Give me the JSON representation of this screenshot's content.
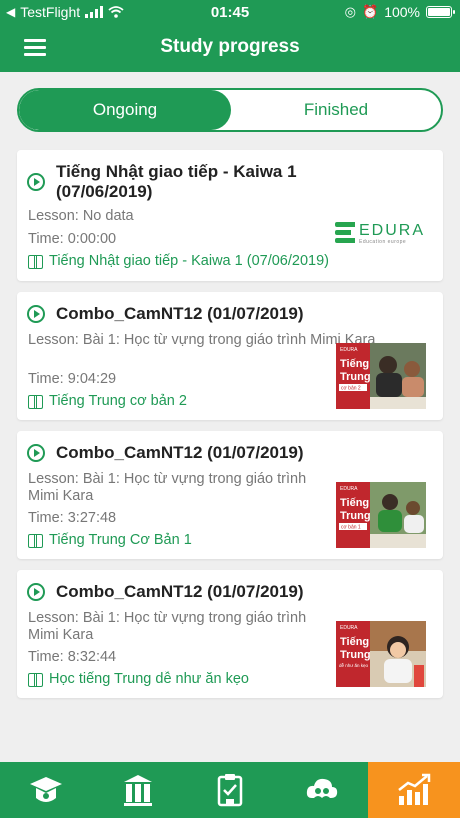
{
  "status_bar": {
    "carrier": "TestFlight",
    "time": "01:45",
    "battery": "100%",
    "battery_level": 1.0
  },
  "header": {
    "title": "Study progress",
    "menu_icon": "menu-icon"
  },
  "tabs": [
    {
      "label": "Ongoing",
      "active": true
    },
    {
      "label": "Finished",
      "active": false
    }
  ],
  "courses": [
    {
      "title": "Tiếng Nhật giao tiếp - Kaiwa 1 (07/06/2019)",
      "lesson": "Lesson: No data",
      "time": "Time: 0:00:00",
      "course": "Tiếng Nhật giao tiếp - Kaiwa 1 (07/06/2019)",
      "thumbnail": "edura-logo",
      "logo": {
        "name": "EDURA",
        "tagline": "Education europe"
      }
    },
    {
      "title": "Combo_CamNT12 (01/07/2019)",
      "lesson": "Lesson: Bài 1: Học từ vựng trong giáo trình Mimi Kara",
      "time": "Time: 9:04:29",
      "course": "Tiếng Trung cơ bản 2",
      "thumbnail": "course-thumbnail",
      "thumb_text": {
        "brand": "EDURA",
        "line1": "Tiếng",
        "line2": "Trung",
        "small": "cơ bản 2"
      }
    },
    {
      "title": "Combo_CamNT12 (01/07/2019)",
      "lesson": "Lesson: Bài 1: Học từ vựng trong giáo trình Mimi Kara",
      "time": "Time: 3:27:48",
      "course": "Tiếng Trung Cơ Bản 1",
      "thumbnail": "course-thumbnail",
      "thumb_text": {
        "brand": "EDURA",
        "line1": "Tiếng",
        "line2": "Trung",
        "small": "cơ bản 1"
      }
    },
    {
      "title": "Combo_CamNT12 (01/07/2019)",
      "lesson": "Lesson: Bài 1: Học từ vựng trong giáo trình Mimi Kara",
      "time": "Time: 8:32:44",
      "course": "Học tiếng Trung dễ như ăn kẹo",
      "thumbnail": "course-thumbnail",
      "thumb_text": {
        "brand": "EDURA",
        "line1": "Tiếng",
        "line2": "Trung",
        "small": "dễ như ăn kẹo"
      }
    }
  ],
  "bottom_tabs": [
    {
      "icon": "graduation-cap-icon",
      "active": false
    },
    {
      "icon": "library-icon",
      "active": false
    },
    {
      "icon": "clipboard-icon",
      "active": false
    },
    {
      "icon": "cloud-users-icon",
      "active": false
    },
    {
      "icon": "bar-chart-icon",
      "active": true
    }
  ],
  "colors": {
    "primary": "#1f9a55",
    "accent": "#f7931e",
    "background": "#efefef",
    "thumb_red": "#c0272d"
  }
}
